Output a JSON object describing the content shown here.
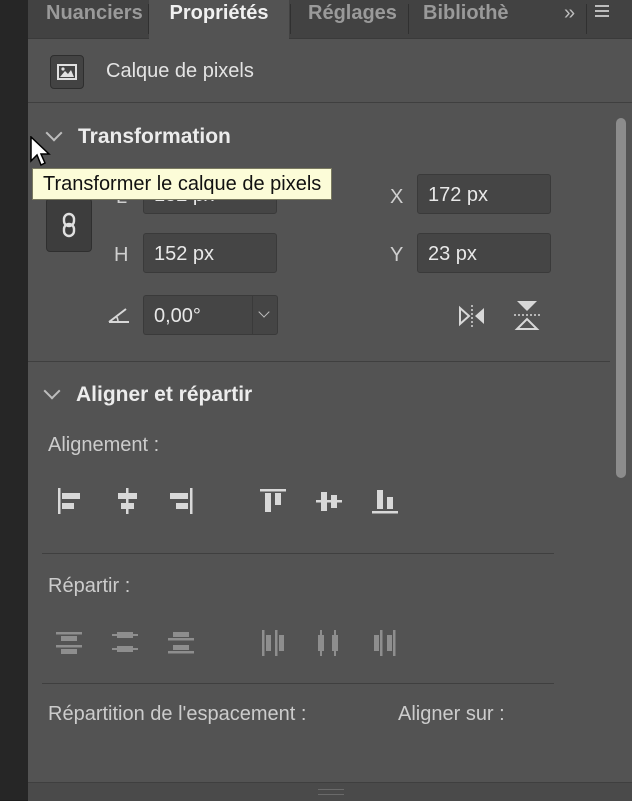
{
  "tabs": [
    {
      "label": "Nuanciers",
      "active": false
    },
    {
      "label": "Propriétés",
      "active": true
    },
    {
      "label": "Réglages",
      "active": false
    },
    {
      "label": "Bibliothè",
      "active": false
    }
  ],
  "tab_overflow": "»",
  "layer": {
    "name": "Calque de pixels",
    "icon": "image-icon"
  },
  "transform": {
    "title": "Transformation",
    "tooltip": "Transformer le calque de pixels",
    "w_label": "L",
    "w_value": "152 px",
    "h_label": "H",
    "h_value": "152 px",
    "x_label": "X",
    "x_value": "172 px",
    "y_label": "Y",
    "y_value": "23 px",
    "angle_value": "0,00°",
    "icons": [
      "link-icon",
      "angle-icon",
      "flip-horizontal-icon",
      "flip-vertical-icon"
    ]
  },
  "align": {
    "title": "Aligner et répartir",
    "alignment_label": "Alignement :",
    "distribute_label": "Répartir :",
    "spacing_label": "Répartition de l'espacement :",
    "align_to_label": "Aligner sur :"
  },
  "colors": {
    "panel_bg": "#535353",
    "tab_bg": "#424242",
    "tooltip_bg": "#fcfcd8",
    "icon": "#d8d8d8",
    "icon_disabled": "#8e8e8e"
  }
}
